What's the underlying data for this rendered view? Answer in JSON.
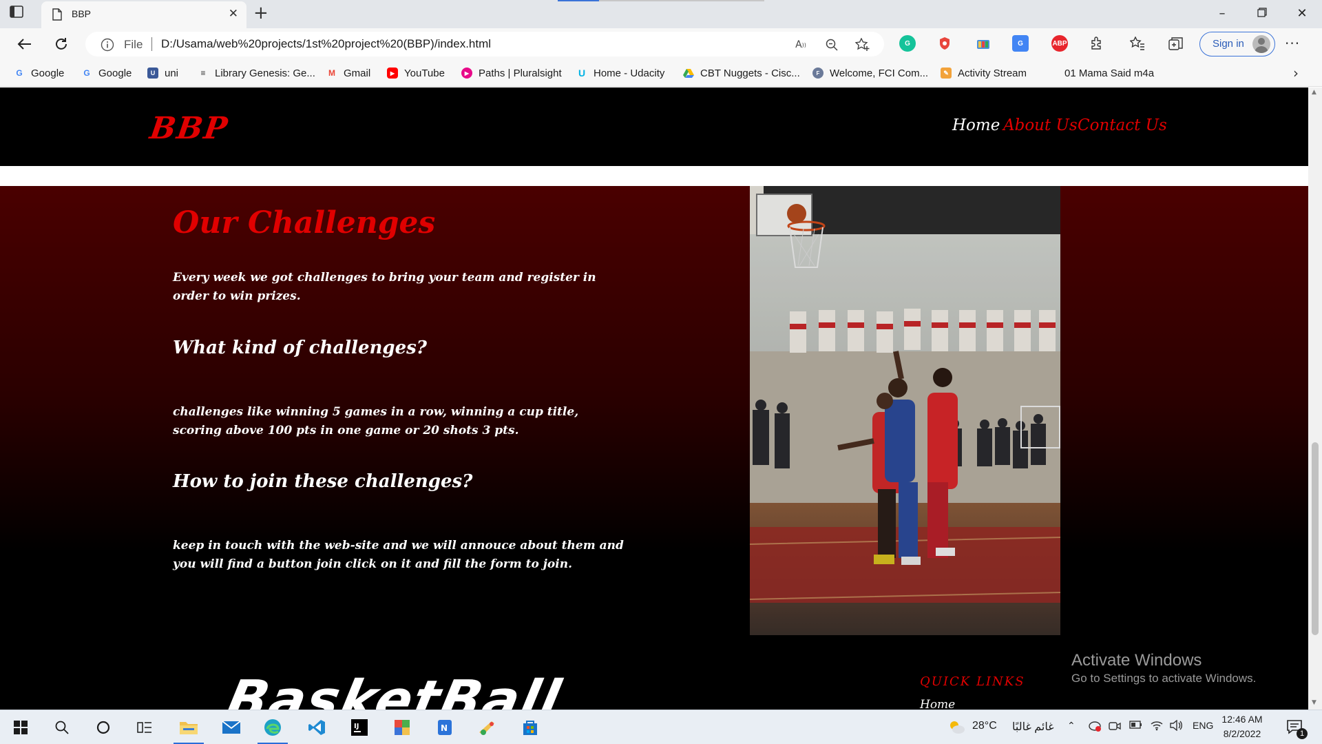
{
  "browser": {
    "tab_title": "BBP",
    "address_scheme_label": "File",
    "url": "D:/Usama/web%20projects/1st%20project%20(BBP)/index.html",
    "sign_in_label": "Sign in"
  },
  "bookmarks": [
    {
      "label": "Google",
      "icon": "google-icon"
    },
    {
      "label": "Google",
      "icon": "google-icon"
    },
    {
      "label": "uni",
      "icon": "uni-icon"
    },
    {
      "label": "Library Genesis: Ge...",
      "icon": "library-icon"
    },
    {
      "label": "Gmail",
      "icon": "gmail-icon"
    },
    {
      "label": "YouTube",
      "icon": "youtube-icon"
    },
    {
      "label": "Paths | Pluralsight",
      "icon": "pluralsight-icon"
    },
    {
      "label": "Home - Udacity",
      "icon": "udacity-icon"
    },
    {
      "label": "CBT Nuggets - Cisc...",
      "icon": "drive-icon"
    },
    {
      "label": "Welcome, FCI Com...",
      "icon": "fci-icon"
    },
    {
      "label": "Activity Stream",
      "icon": "activity-icon"
    },
    {
      "label": "01 Mama Said m4a",
      "icon": "none"
    }
  ],
  "site": {
    "logo": "BBP",
    "nav": [
      {
        "label": "Home",
        "color": "#ffffff"
      },
      {
        "label": "About Us",
        "color": "#e00000"
      },
      {
        "label": "Contact Us",
        "color": "#e00000"
      }
    ],
    "challenges": {
      "title": "Our Challenges",
      "intro": "Every week we got challenges to bring your team and register in order to win prizes.",
      "q1": "What kind of challenges?",
      "a1": "challenges like winning 5 games in a row, winning a cup title, scoring above 100 pts in one game or 20 shots 3 pts.",
      "q2": "How to join these challenges?",
      "a2": "keep in touch with the web-site and we will annouce about them and you will find a button join click on it and fill the form to join."
    },
    "footer": {
      "logo_text": "BasketBall",
      "quick_links_title": "QUICK LINKS",
      "quick_links": [
        "Home"
      ]
    }
  },
  "windows_watermark": {
    "title": "Activate Windows",
    "subtitle": "Go to Settings to activate Windows."
  },
  "taskbar": {
    "weather_temp": "28°C",
    "weather_desc": "غائم غالبًا",
    "language": "ENG",
    "time": "12:46 AM",
    "date": "8/2/2022",
    "notification_count": "1"
  },
  "colors": {
    "accent_red": "#e00000",
    "header_bg": "#000000",
    "hero_top": "#4a0000"
  }
}
